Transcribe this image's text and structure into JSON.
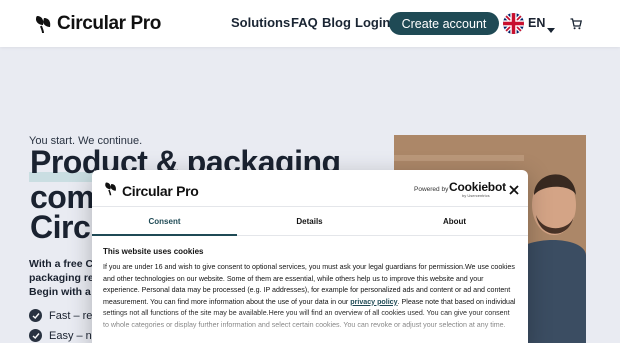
{
  "header": {
    "brand": "Circular Pro",
    "nav": [
      "Solutions",
      "FAQ",
      "Blog",
      "Login"
    ],
    "cta_label": "Create account",
    "language": "EN",
    "icons": [
      "uk-flag-icon",
      "chevron-down-icon",
      "cart-icon"
    ]
  },
  "hero": {
    "kicker": "You start. We continue.",
    "headline_lines": [
      "Product & packaging",
      "com",
      "Circ"
    ],
    "body_lines": [
      "With a free C",
      "packaging re",
      "Begin with a"
    ],
    "checks": [
      "Fast – res",
      "Easy – no"
    ]
  },
  "cookie_dialog": {
    "brand": "Circular Pro",
    "powered_by": "Powered by",
    "provider": "Cookiebot",
    "provider_sub": "by Usercentrics",
    "tabs": [
      "Consent",
      "Details",
      "About"
    ],
    "active_tab": "Consent",
    "title": "This website uses cookies",
    "text_before_link": "If you are under 16 and wish to give consent to optional services, you must ask your legal guardians for permission.We use cookies and other technologies on our website. Some of them are essential, while others help us to improve this website and your experience. Personal data may be processed (e.g. IP addresses), for example for personalized ads and content or ad and content measurement. You can find more information about the use of your data in our ",
    "link_text": "privacy policy",
    "text_after_link": ". Please note that based on individual settings not all functions of the site may be available.Here you will find an overview of all cookies used. You can give your consent to whole categories or display further information and select certain cookies. You can revoke or adjust your selection at any time."
  },
  "colors": {
    "accent": "#1f4a55",
    "page_bg": "#eef0f6",
    "highlight": "#cfe3e6"
  }
}
